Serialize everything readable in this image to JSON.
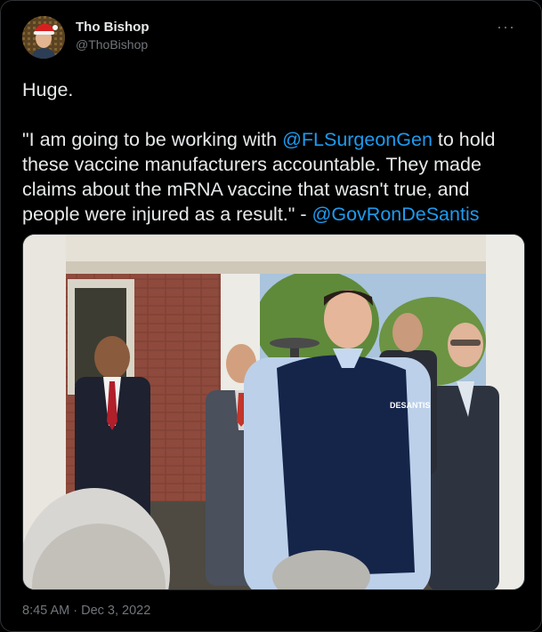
{
  "user": {
    "display_name": "Tho Bishop",
    "handle": "@ThoBishop"
  },
  "tweet": {
    "line1": "Huge.",
    "quote_open": "\"I am going to be working with ",
    "mention1": "@FLSurgeonGen",
    "quote_mid": " to hold these vaccine manufacturers accountable. They made claims about the mRNA vaccine that wasn't true, and people were injured as a result.\" - ",
    "mention2": "@GovRonDeSantis",
    "photo_vest_text": "DESANTIS"
  },
  "meta": {
    "time": "8:45 AM",
    "separator": " · ",
    "date": "Dec 3, 2022"
  },
  "icons": {
    "more": "more-icon",
    "avatar": "avatar"
  },
  "colors": {
    "background": "#000000",
    "text": "#e7e9ea",
    "secondary": "#71767b",
    "link": "#1d9bf0"
  }
}
